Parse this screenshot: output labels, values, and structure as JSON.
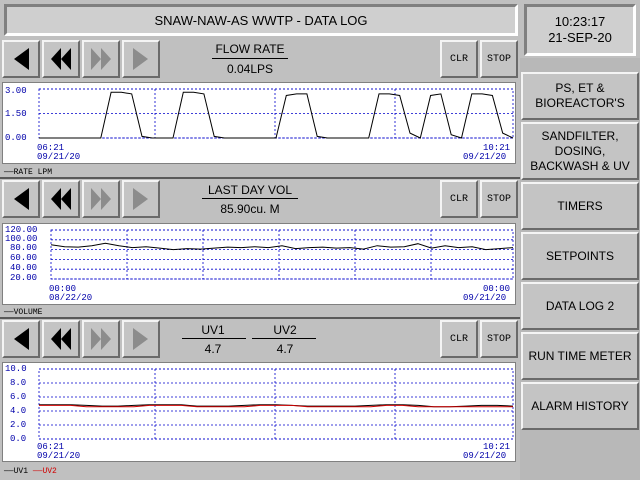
{
  "title": "SNAW-NAW-AS WWTP - DATA LOG",
  "clock": {
    "time": "10:23:17",
    "date": "21-SEP-20"
  },
  "menu": [
    "PS, ET & BIOREACTOR'S",
    "SANDFILTER, DOSING, BACKWASH & UV",
    "TIMERS",
    "SETPOINTS",
    "DATA LOG 2",
    "RUN TIME METER",
    "ALARM HISTORY"
  ],
  "buttons": {
    "clr": "CLR",
    "stop": "STOP"
  },
  "panels": [
    {
      "label": "FLOW RATE",
      "value": "0.04LPS",
      "legend": "RATE LPM",
      "x_start": [
        "06:21",
        "09/21/20"
      ],
      "x_end": [
        "10:21",
        "09/21/20"
      ],
      "y_ticks": [
        "3.00",
        "1.50",
        "0.00"
      ]
    },
    {
      "label": "LAST DAY VOL",
      "value": "85.90cu. M",
      "legend": "VOLUME",
      "x_start": [
        "00:00",
        "08/22/20"
      ],
      "x_end": [
        "00:00",
        "09/21/20"
      ],
      "y_ticks": [
        "120.00",
        "100.00",
        "80.00",
        "60.00",
        "40.00",
        "20.00"
      ]
    },
    {
      "label1": "UV1",
      "value1": "4.7",
      "label2": "UV2",
      "value2": "4.7",
      "legend1": "UV1",
      "legend2": "UV2",
      "x_start": [
        "06:21",
        "09/21/20"
      ],
      "x_end": [
        "10:21",
        "09/21/20"
      ],
      "y_ticks": [
        "10.0",
        "8.0",
        "6.0",
        "4.0",
        "2.0",
        "0.0"
      ]
    }
  ],
  "chart_data": [
    {
      "type": "line",
      "ylim": [
        0,
        3
      ],
      "series": [
        {
          "values": [
            0,
            0,
            0,
            0,
            0,
            0,
            0,
            2.8,
            2.8,
            2.7,
            0.1,
            0,
            0,
            0,
            2.8,
            2.8,
            2.7,
            0.1,
            0,
            0,
            0,
            0,
            0,
            0,
            2.6,
            2.7,
            2.7,
            0.1,
            0,
            0,
            0,
            0,
            0,
            2.7,
            2.7,
            2.6,
            0.3,
            0,
            2.6,
            2.7,
            0.2,
            0,
            2.7,
            2.7,
            2.6,
            0.3,
            0
          ]
        }
      ]
    },
    {
      "type": "line",
      "ylim": [
        20,
        120
      ],
      "series": [
        {
          "values": [
            90,
            86,
            85,
            88,
            93,
            88,
            84,
            86,
            83,
            80,
            82,
            81,
            83,
            85,
            84,
            86,
            84,
            88,
            82,
            84,
            85,
            83,
            84,
            81,
            88,
            85,
            86,
            92,
            83,
            88,
            84,
            86,
            80,
            82,
            84
          ]
        }
      ]
    },
    {
      "type": "line",
      "ylim": [
        0,
        10
      ],
      "colors": [
        "#000000",
        "#d00000"
      ],
      "series": [
        {
          "name": "UV1",
          "values": [
            4.9,
            4.9,
            4.9,
            4.8,
            4.7,
            4.7,
            4.8,
            4.9,
            4.9,
            4.9,
            4.7,
            4.7,
            4.7,
            4.8,
            4.9,
            4.9,
            4.8,
            4.7,
            4.7,
            4.7,
            4.7,
            4.8,
            4.9,
            4.9,
            4.8,
            4.6,
            4.6,
            4.7,
            4.8,
            4.8,
            4.7
          ]
        },
        {
          "name": "UV2",
          "values": [
            4.8,
            4.8,
            4.8,
            4.6,
            4.6,
            4.6,
            4.6,
            4.8,
            4.8,
            4.8,
            4.6,
            4.6,
            4.6,
            4.6,
            4.8,
            4.8,
            4.8,
            4.6,
            4.6,
            4.6,
            4.6,
            4.6,
            4.8,
            4.8,
            4.6,
            4.6,
            4.6,
            4.6,
            4.6,
            4.6,
            4.6
          ]
        }
      ]
    }
  ]
}
